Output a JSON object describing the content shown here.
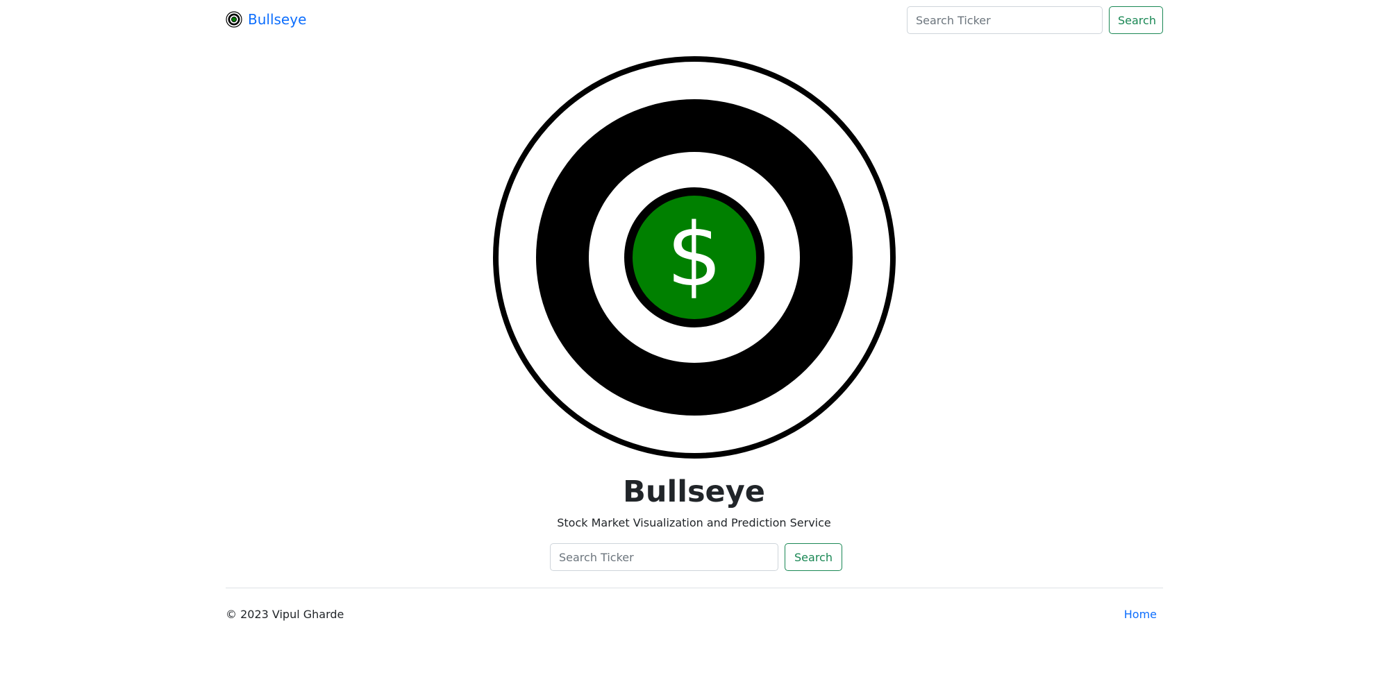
{
  "navbar": {
    "brand_label": "Bullseye",
    "logo_icon": "bullseye-dollar-icon",
    "search_placeholder": "Search Ticker",
    "search_button_label": "Search"
  },
  "hero": {
    "logo_icon": "bullseye-dollar-icon",
    "logo_symbol": "$",
    "title": "Bullseye",
    "subtitle": "Stock Market Visualization and Prediction Service",
    "search_placeholder": "Search Ticker",
    "search_button_label": "Search"
  },
  "footer": {
    "copyright": "© 2023 Vipul Gharde",
    "home_link_label": "Home"
  },
  "colors": {
    "brand_link": "#0d6efd",
    "button_outline": "#198754",
    "target_black": "#000000",
    "target_green": "#008000",
    "text": "#212529"
  }
}
